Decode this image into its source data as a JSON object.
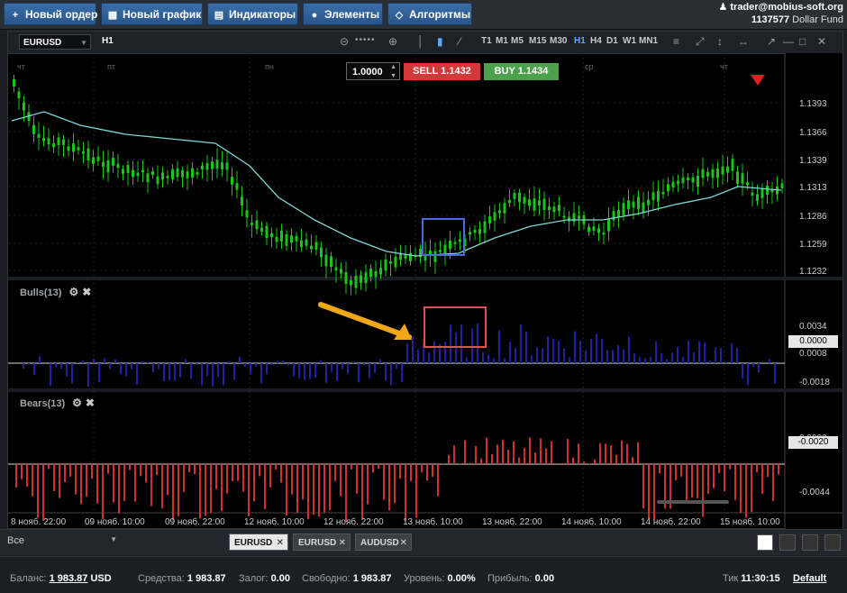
{
  "toolbar": {
    "new_order": "Новый ордер",
    "new_chart": "Новый график",
    "indicators": "Индикаторы",
    "elements": "Элементы",
    "algorithms": "Алгоритмы"
  },
  "account": {
    "user": "trader@mobius-soft.org",
    "number": "1137577",
    "fund": "Dollar Fund"
  },
  "chart": {
    "symbol": "EURUSD",
    "timeframe_current": "H1",
    "timeframes": [
      "T1",
      "M1",
      "M5",
      "M15",
      "M30",
      "H1",
      "H4",
      "D1",
      "W1",
      "MN1"
    ],
    "quantity": "1.0000",
    "sell_label": "SELL",
    "sell_price": "1.1432",
    "buy_label": "BUY",
    "buy_price": "1.1434",
    "day_labels": [
      "чт",
      "пт",
      "пн",
      "ср",
      "чт"
    ],
    "price_ticks": [
      "1.1393",
      "1.1366",
      "1.1339",
      "1.1313",
      "1.1286",
      "1.1259",
      "1.1232"
    ],
    "bulls_title": "Bulls(13)",
    "bulls_ticks": [
      "0.0034",
      "0.0008",
      "-0.0018"
    ],
    "bulls_current": "0.0000",
    "bears_title": "Bears(13)",
    "bears_ticks": [
      "0.0002",
      "-0.0044"
    ],
    "bears_current": "-0.0020",
    "time_labels": [
      "8 нояб. 22:00",
      "09 нояб. 10:00",
      "09 нояб. 22:00",
      "12 нояб. 10:00",
      "12 нояб. 22:00",
      "13 нояб. 10:00",
      "13 нояб. 22:00",
      "14 нояб. 10:00",
      "14 нояб. 22:00",
      "15 нояб. 10:00"
    ],
    "colors": {
      "bull": "#18c518",
      "ma": "#7dd8d8",
      "bulls_bar": "#2020a0",
      "bears_bar": "#d03030",
      "highlight_blue": "#4a6be0",
      "highlight_red": "#e05050",
      "arrow": "#f0a818"
    }
  },
  "bottom": {
    "filter": "Все",
    "tabs": [
      "EURUSD",
      "EURUSD",
      "AUDUSD"
    ]
  },
  "status": {
    "balance_label": "Баланс:",
    "balance": "1 983.87",
    "currency": "USD",
    "equity_label": "Средства:",
    "equity": "1 983.87",
    "margin_label": "Залог:",
    "margin": "0.00",
    "free_label": "Свободно:",
    "free": "1 983.87",
    "level_label": "Уровень:",
    "level": "0.00%",
    "profit_label": "Прибыль:",
    "profit": "0.00",
    "tick_label": "Тик",
    "time": "11:30:15",
    "profile": "Default"
  }
}
